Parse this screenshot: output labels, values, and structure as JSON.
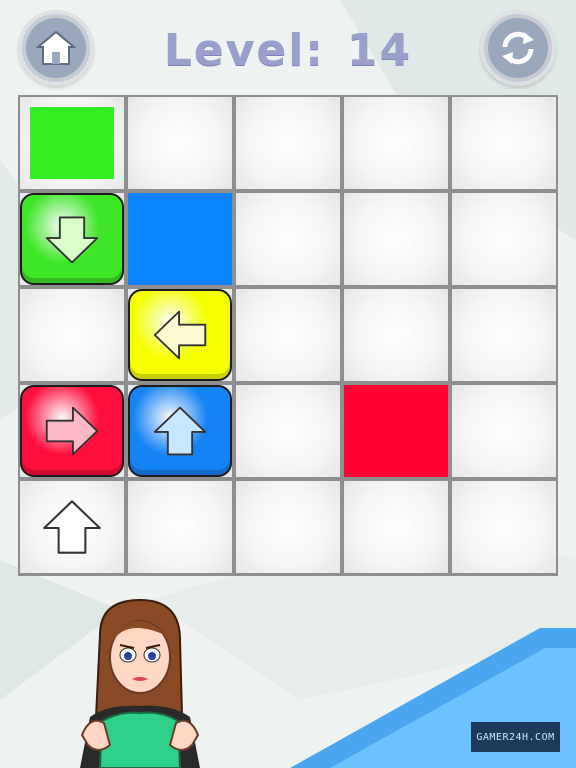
{
  "header": {
    "level_label": "Level:",
    "level_number": "14"
  },
  "buttons": {
    "home_icon": "home-icon",
    "restart_icon": "restart-icon"
  },
  "board": {
    "rows": 5,
    "cols": 5,
    "targets": [
      {
        "row": 0,
        "col": 0,
        "color": "#33ee22"
      },
      {
        "row": 1,
        "col": 1,
        "color": "#0b82ff"
      },
      {
        "row": 3,
        "col": 3,
        "color": "#ff0033"
      }
    ],
    "tiles": [
      {
        "row": 1,
        "col": 0,
        "color": "#3fe628",
        "direction": "down",
        "arrow_fill": "#d9ffc9"
      },
      {
        "row": 2,
        "col": 1,
        "color": "#f5ff00",
        "direction": "left",
        "arrow_fill": "#fffbd0"
      },
      {
        "row": 3,
        "col": 0,
        "color": "#ff0d3c",
        "direction": "right",
        "arrow_fill": "#ffb9c6"
      },
      {
        "row": 3,
        "col": 1,
        "color": "#1683f5",
        "direction": "up",
        "arrow_fill": "#c7e6ff"
      }
    ],
    "hint_arrow": {
      "row": 4,
      "col": 0,
      "direction": "up",
      "fill": "#ffffff"
    }
  },
  "watermark": "GAMER24H.COM"
}
